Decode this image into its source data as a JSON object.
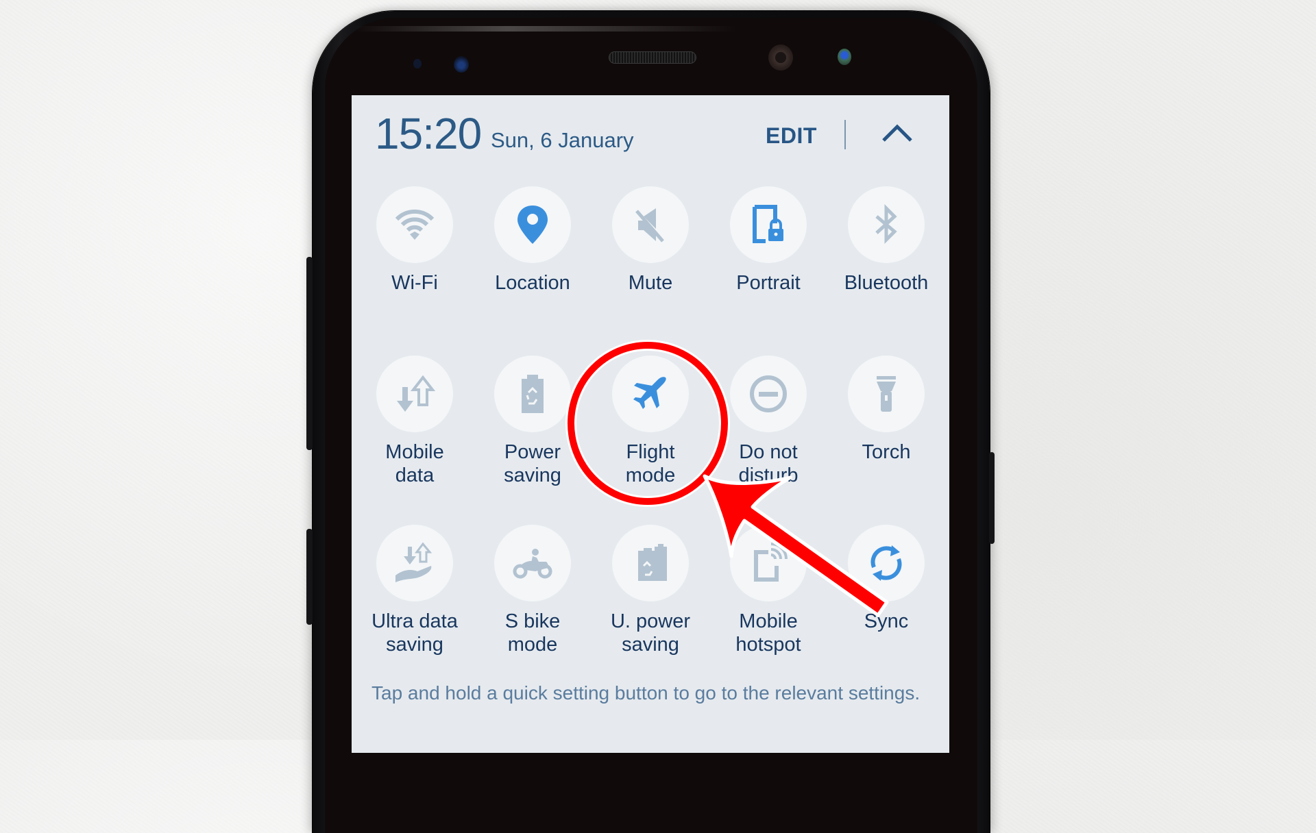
{
  "panel": {
    "time": "15:20",
    "date": "Sun, 6 January",
    "edit_label": "EDIT",
    "collapse_icon": "chevron-up-icon"
  },
  "colors": {
    "panel_bg": "#e6eaee",
    "tile_bg": "#f4f6f8",
    "icon_inactive": "#b2c2d0",
    "icon_active": "#3a8fdd",
    "label_text": "#18365e",
    "header_text": "#2c5a86",
    "annotation_red": "#ff0000"
  },
  "quick_settings": [
    {
      "label": "Wi-Fi",
      "icon": "wifi-icon",
      "active": false
    },
    {
      "label": "Location",
      "icon": "location-pin-icon",
      "active": true
    },
    {
      "label": "Mute",
      "icon": "mute-icon",
      "active": false
    },
    {
      "label": "Portrait",
      "icon": "portrait-lock-icon",
      "active": true
    },
    {
      "label": "Bluetooth",
      "icon": "bluetooth-icon",
      "active": false
    },
    {
      "label": "Mobile\ndata",
      "icon": "mobile-data-icon",
      "active": false
    },
    {
      "label": "Power\nsaving",
      "icon": "power-saving-icon",
      "active": false
    },
    {
      "label": "Flight\nmode",
      "icon": "airplane-icon",
      "active": true
    },
    {
      "label": "Do not\ndisturb",
      "icon": "do-not-disturb-icon",
      "active": false
    },
    {
      "label": "Torch",
      "icon": "torch-icon",
      "active": false
    },
    {
      "label": "Ultra data\nsaving",
      "icon": "ultra-data-saving-icon",
      "active": false
    },
    {
      "label": "S bike\nmode",
      "icon": "motorbike-icon",
      "active": false
    },
    {
      "label": "U. power\nsaving",
      "icon": "ultra-power-saving-icon",
      "active": false
    },
    {
      "label": "Mobile\nhotspot",
      "icon": "hotspot-icon",
      "active": false
    },
    {
      "label": "Sync",
      "icon": "sync-icon",
      "active": true
    }
  ],
  "footer": {
    "hint": "Tap and hold a quick setting button to go to the relevant settings."
  },
  "annotation": {
    "highlighted_item": "Flight mode",
    "shape": "red circle with arrow"
  }
}
